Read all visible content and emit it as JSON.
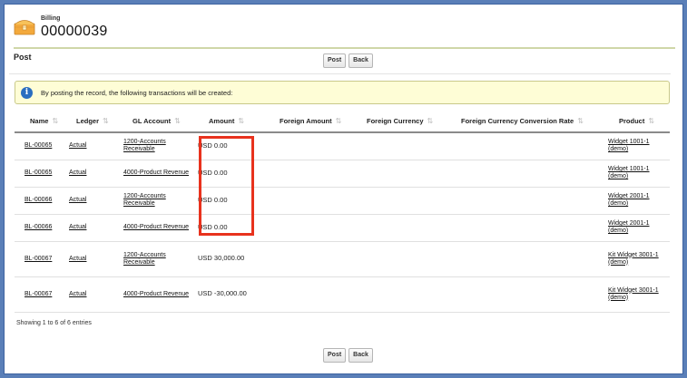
{
  "header": {
    "object_type": "Billing",
    "record_name": "00000039"
  },
  "section": {
    "title": "Post",
    "buttons": {
      "post": "Post",
      "back": "Back"
    }
  },
  "info": {
    "message": "By posting the record, the following transactions will be created:"
  },
  "table": {
    "columns": [
      "Name",
      "Ledger",
      "GL Account",
      "Amount",
      "Foreign Amount",
      "Foreign Currency",
      "Foreign Currency Conversion Rate",
      "Product"
    ],
    "rows": [
      {
        "name": "BL-00065",
        "ledger": "Actual",
        "gl_account": "1200-Accounts Receivable",
        "amount": "USD 0.00",
        "foreign_amount": "",
        "foreign_currency": "",
        "conversion_rate": "",
        "product": "Widget 1001-1 (demo)"
      },
      {
        "name": "BL-00065",
        "ledger": "Actual",
        "gl_account": "4000-Product Revenue",
        "amount": "USD 0.00",
        "foreign_amount": "",
        "foreign_currency": "",
        "conversion_rate": "",
        "product": "Widget 1001-1 (demo)"
      },
      {
        "name": "BL-00066",
        "ledger": "Actual",
        "gl_account": "1200-Accounts Receivable",
        "amount": "USD 0.00",
        "foreign_amount": "",
        "foreign_currency": "",
        "conversion_rate": "",
        "product": "Widget 2001-1 (demo)"
      },
      {
        "name": "BL-00066",
        "ledger": "Actual",
        "gl_account": "4000-Product Revenue",
        "amount": "USD 0.00",
        "foreign_amount": "",
        "foreign_currency": "",
        "conversion_rate": "",
        "product": "Widget 2001-1 (demo)"
      },
      {
        "name": "BL-00067",
        "ledger": "Actual",
        "gl_account": "1200-Accounts Receivable",
        "amount": "USD 30,000.00",
        "foreign_amount": "",
        "foreign_currency": "",
        "conversion_rate": "",
        "product": "Kit Widget 3001-1 (demo)"
      },
      {
        "name": "BL-00067",
        "ledger": "Actual",
        "gl_account": "4000-Product Revenue",
        "amount": "USD -30,000.00",
        "foreign_amount": "",
        "foreign_currency": "",
        "conversion_rate": "",
        "product": "Kit Widget 3001-1 (demo)"
      }
    ]
  },
  "footer": {
    "entries_text": "Showing 1 to 6 of 6 entries"
  },
  "colors": {
    "highlight": "#e8321d",
    "info_bg": "#fefdd6",
    "info_icon": "#2a6ec0",
    "frame": "#3e62a0"
  },
  "icons": {
    "app": "treasure-chest-icon",
    "info": "info-icon",
    "sort": "sort-icon"
  }
}
